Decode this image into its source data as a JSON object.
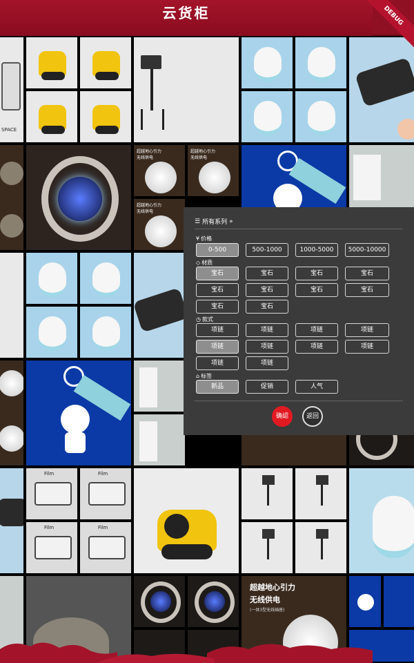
{
  "app": {
    "title": "云货柜",
    "debug_label": "DEBUG"
  },
  "tiles": {
    "camera_caption": "SPACE",
    "film_label": "Film",
    "moon_text_small": "超越地心引力\n无线供电",
    "moon_text_large_1": "超越地心引力",
    "moon_text_large_2": "无线供电",
    "moon_text_small_sub": "(一体3型无线插座)"
  },
  "filter": {
    "title": "所有系列",
    "sections": [
      {
        "label": "价格",
        "icon": "yen-icon",
        "options": [
          "0-500",
          "500-1000",
          "1000-5000",
          "5000-10000"
        ],
        "selected": [
          0
        ]
      },
      {
        "label": "材质",
        "icon": "gem-icon",
        "options": [
          "宝石",
          "宝石",
          "宝石",
          "宝石",
          "宝石",
          "宝石",
          "宝石",
          "宝石",
          "宝石",
          "宝石"
        ],
        "selected": [
          0
        ]
      },
      {
        "label": "款式",
        "icon": "clock-icon",
        "options": [
          "项链",
          "项链",
          "项链",
          "项链",
          "项链",
          "项链",
          "项链",
          "项链",
          "项链",
          "项链"
        ],
        "selected": [
          4
        ]
      },
      {
        "label": "标签",
        "icon": "tag-icon",
        "options": [
          "新品",
          "促销",
          "人气"
        ],
        "selected": [
          0
        ]
      }
    ],
    "confirm_label": "确認",
    "back_label": "返回"
  },
  "colors": {
    "header": "#8f0f23",
    "panel_bg": "#3b3b3b",
    "confirm": "#e11a22",
    "chip_selected": "#8e8e8e"
  }
}
